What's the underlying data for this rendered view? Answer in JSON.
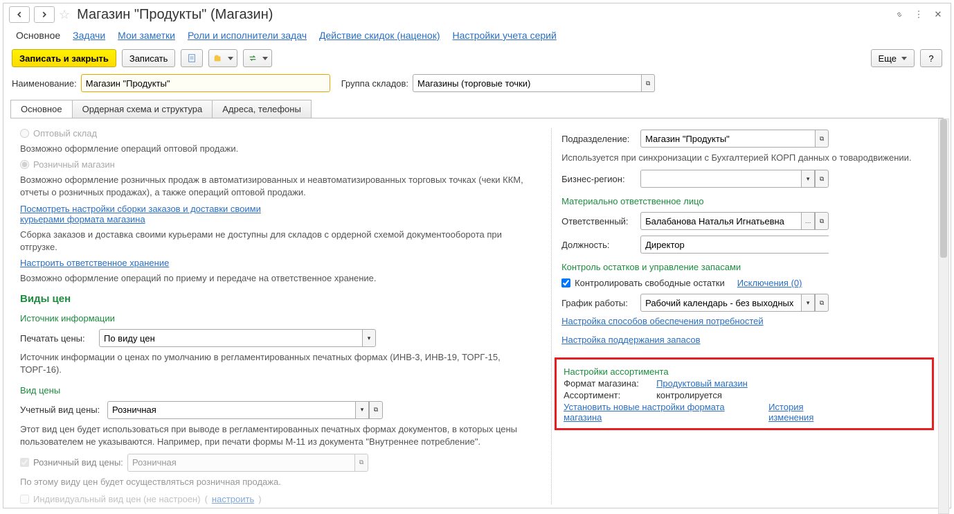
{
  "header": {
    "title": "Магазин \"Продукты\" (Магазин)"
  },
  "nav": {
    "tab0": "Основное",
    "tab1": "Задачи",
    "tab2": "Мои заметки",
    "tab3": "Роли и исполнители задач",
    "tab4": "Действие скидок (наценок)",
    "tab5": "Настройки учета серий"
  },
  "toolbar": {
    "write_close": "Записать и закрыть",
    "write": "Записать",
    "more": "Еще"
  },
  "fields": {
    "name_label": "Наименование:",
    "name_value": "Магазин \"Продукты\"",
    "group_label": "Группа складов:",
    "group_value": "Магазины (торговые точки)"
  },
  "tabs": {
    "t0": "Основное",
    "t1": "Ордерная схема и структура",
    "t2": "Адреса, телефоны"
  },
  "left": {
    "opt_wholesale": "Оптовый склад",
    "wholesale_desc": "Возможно оформление операций оптовой продажи.",
    "opt_retail": "Розничный магазин",
    "retail_desc": "Возможно оформление розничных продаж в автоматизированных и неавтоматизированных торговых точках (чеки ККМ, отчеты о розничных продажах), а также операций оптовой продажи.",
    "link_assembly": "Посмотреть настройки сборки заказов и доставки своими курьерами формата магазина",
    "assembly_desc": "Сборка заказов и доставка своими курьерами не доступны для складов с ордерной схемой документооборота при отгрузке.",
    "link_storage": "Настроить ответственное хранение",
    "storage_desc": "Возможно оформление операций по приему и передаче на ответственное хранение.",
    "price_header": "Виды цен",
    "source_header": "Источник информации",
    "print_prices_label": "Печатать цены:",
    "print_prices_value": "По виду цен",
    "source_desc": "Источник информации о ценах по умолчанию в регламентированных печатных формах (ИНВ-3, ИНВ-19, ТОРГ-15, ТОРГ-16).",
    "price_type_header": "Вид цены",
    "acc_price_label": "Учетный вид цены:",
    "acc_price_value": "Розничная",
    "acc_price_desc": "Этот вид цен будет использоваться при выводе в регламентированных печатных формах документов, в которых цены пользователем не указываются. Например, при печати формы М-11 из документа \"Внутреннее потребление\".",
    "retail_price_label": "Розничный вид цены:",
    "retail_price_value": "Розничная",
    "retail_price_desc": "По этому виду цен будет осуществляться розничная продажа.",
    "individual_label": "Индивидуальный вид цен (не настроен)",
    "individual_link": "настроить"
  },
  "right": {
    "division_label": "Подразделение:",
    "division_value": "Магазин \"Продукты\"",
    "division_desc": "Используется при синхронизации с Бухгалтерией КОРП данных о товародвижении.",
    "region_label": "Бизнес-регион:",
    "region_value": "",
    "resp_header": "Материально ответственное лицо",
    "resp_label": "Ответственный:",
    "resp_value": "Балабанова Наталья Игнатьевна",
    "pos_label": "Должность:",
    "pos_value": "Директор",
    "stock_header": "Контроль остатков и управление запасами",
    "ctrl_label": "Контролировать свободные остатки",
    "excl_link": "Исключения (0)",
    "sched_label": "График работы:",
    "sched_value": "Рабочий календарь - без выходных",
    "link_supply": "Настройка способов обеспечения потребностей",
    "link_stock": "Настройка поддержания запасов",
    "asrt_header": "Настройки ассортимента",
    "fmt_label": "Формат магазина:",
    "fmt_link": "Продуктовый магазин",
    "asrt_label": "Ассортимент:",
    "asrt_value": "контролируется",
    "link_new_settings": "Установить новые настройки формата магазина",
    "link_history": "История изменения"
  }
}
